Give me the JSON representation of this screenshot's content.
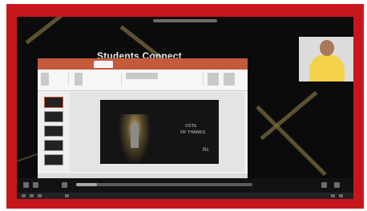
{
  "meeting": {
    "title": "Students Connect",
    "colors": {
      "frame_border": "#c8161d",
      "screen_bg": "#0b0b0c",
      "ppt_accent": "#c55a3a"
    }
  },
  "webcam": {
    "participant": "presenter"
  },
  "slide": {
    "line1": "VOTE",
    "line2": "OF THANKS",
    "mark": "Rs"
  },
  "playback": {
    "progress": 0.12
  }
}
